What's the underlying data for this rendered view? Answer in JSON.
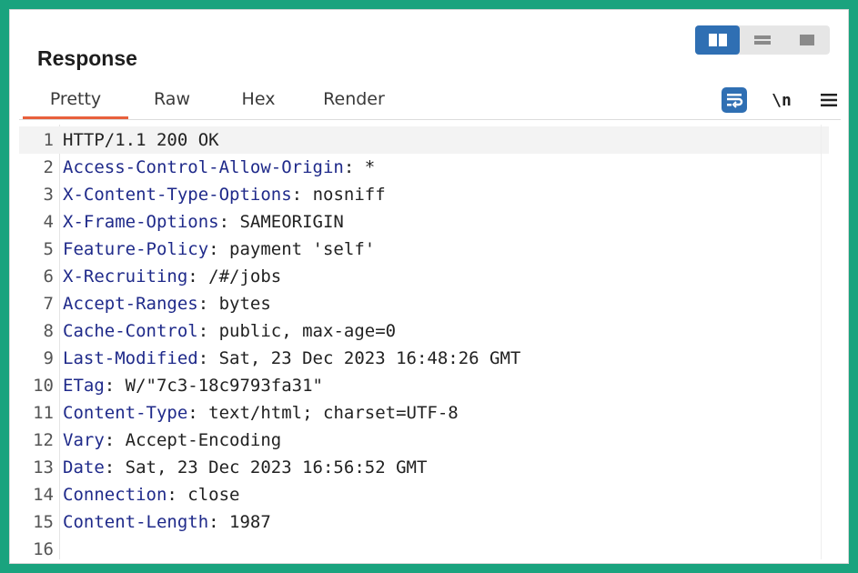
{
  "panel": {
    "title": "Response"
  },
  "layout_buttons": [
    {
      "name": "side-by-side",
      "active": true
    },
    {
      "name": "horizontal",
      "active": false
    },
    {
      "name": "vertical",
      "active": false
    }
  ],
  "tabs": [
    {
      "label": "Pretty",
      "active": true
    },
    {
      "label": "Raw",
      "active": false
    },
    {
      "label": "Hex",
      "active": false
    },
    {
      "label": "Render",
      "active": false
    }
  ],
  "toolbar": {
    "newline_label": "\\n"
  },
  "lines": [
    {
      "num": "1",
      "key": "HTTP/1.1 200 OK",
      "sep": "",
      "value": ""
    },
    {
      "num": "2",
      "key": "Access-Control-Allow-Origin",
      "sep": ": ",
      "value": "*"
    },
    {
      "num": "3",
      "key": "X-Content-Type-Options",
      "sep": ": ",
      "value": "nosniff"
    },
    {
      "num": "4",
      "key": "X-Frame-Options",
      "sep": ": ",
      "value": "SAMEORIGIN"
    },
    {
      "num": "5",
      "key": "Feature-Policy",
      "sep": ": ",
      "value": "payment 'self'"
    },
    {
      "num": "6",
      "key": "X-Recruiting",
      "sep": ": ",
      "value": "/#/jobs"
    },
    {
      "num": "7",
      "key": "Accept-Ranges",
      "sep": ": ",
      "value": "bytes"
    },
    {
      "num": "8",
      "key": "Cache-Control",
      "sep": ": ",
      "value": "public, max-age=0"
    },
    {
      "num": "9",
      "key": "Last-Modified",
      "sep": ": ",
      "value": "Sat, 23 Dec 2023 16:48:26 GMT"
    },
    {
      "num": "10",
      "key": "ETag",
      "sep": ": ",
      "value": "W/\"7c3-18c9793fa31\""
    },
    {
      "num": "11",
      "key": "Content-Type",
      "sep": ": ",
      "value": "text/html; charset=UTF-8"
    },
    {
      "num": "12",
      "key": "Vary",
      "sep": ": ",
      "value": "Accept-Encoding"
    },
    {
      "num": "13",
      "key": "Date",
      "sep": ": ",
      "value": "Sat, 23 Dec 2023 16:56:52 GMT"
    },
    {
      "num": "14",
      "key": "Connection",
      "sep": ": ",
      "value": "close"
    },
    {
      "num": "15",
      "key": "Content-Length",
      "sep": ": ",
      "value": "1987"
    },
    {
      "num": "16",
      "key": "",
      "sep": "",
      "value": ""
    }
  ],
  "colors": {
    "background": "#1aa37e",
    "active_layout": "#2f6fb3",
    "active_tab_underline": "#e8603c",
    "header_key": "#1f2a8a",
    "wrap_icon": "#2f6fb3"
  }
}
